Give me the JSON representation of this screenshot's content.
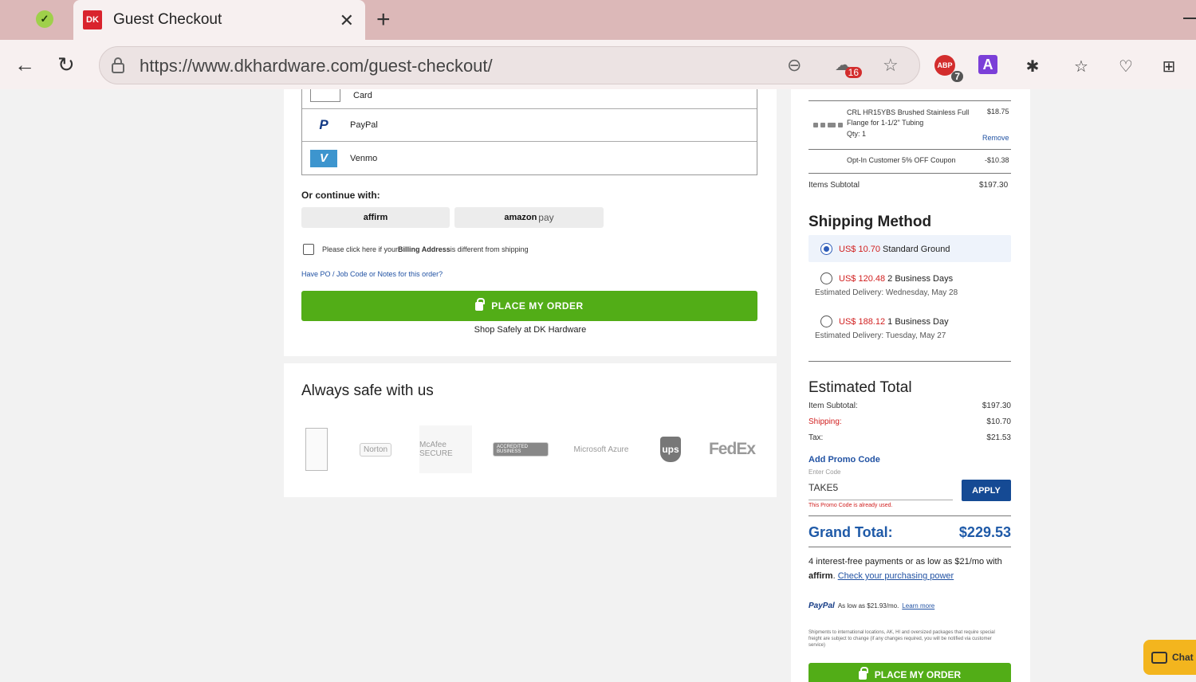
{
  "browser": {
    "tab_title": "Guest Checkout",
    "favicon_text": "DK",
    "url": "https://www.dkhardware.com/guest-checkout/",
    "ext_badge_count": "16",
    "abp_label": "ABP",
    "abp_badge": "7",
    "a_ext_label": "A"
  },
  "payment": {
    "options": [
      {
        "label": "Card",
        "icon": "card-icon"
      },
      {
        "label": "PayPal",
        "icon": "paypal-icon"
      },
      {
        "label": "Venmo",
        "icon": "venmo-icon"
      }
    ],
    "continue_label": "Or continue with:",
    "affirm_label": "affirm",
    "amazon_label_a": "amazon",
    "amazon_label_b": "pay",
    "billing_text_1": "Please click here if your ",
    "billing_text_bold": "Billing Address",
    "billing_text_2": " is different from shipping",
    "po_link": "Have PO / Job Code or Notes for this order?",
    "place_order": "PLACE MY ORDER",
    "shop_safely": "Shop Safely at DK Hardware"
  },
  "safe": {
    "title": "Always safe with us",
    "logos": [
      "Norton",
      "McAfee SECURE",
      "ACCREDITED BUSINESS",
      "Microsoft Azure",
      "ups",
      "FedEx"
    ]
  },
  "cart": {
    "item_name": "CRL HR15YBS Brushed Stainless Full Flange for 1-1/2\" Tubing",
    "item_qty": "Qty: 1",
    "item_price": "$18.75",
    "remove": "Remove",
    "coupon_label": "Opt-In Customer 5% OFF Coupon",
    "coupon_value": "-$10.38",
    "items_subtotal_label": "Items Subtotal",
    "items_subtotal_value": "$197.30"
  },
  "shipping": {
    "title": "Shipping Method",
    "options": [
      {
        "price": "US$ 10.70",
        "name": "Standard Ground",
        "est": "",
        "selected": true
      },
      {
        "price": "US$ 120.48",
        "name": "2 Business Days",
        "est": "Estimated Delivery: Wednesday, May 28",
        "selected": false
      },
      {
        "price": "US$ 188.12",
        "name": "1 Business Day",
        "est": "Estimated Delivery: Tuesday, May 27",
        "selected": false
      }
    ]
  },
  "totals": {
    "title": "Estimated Total",
    "item_subtotal_label": "Item Subtotal:",
    "item_subtotal_value": "$197.30",
    "shipping_label": "Shipping:",
    "shipping_value": "$10.70",
    "tax_label": "Tax:",
    "tax_value": "$21.53",
    "promo_link": "Add Promo Code",
    "promo_hint": "Enter Code",
    "promo_value": "TAKE5",
    "apply": "APPLY",
    "promo_error": "This Promo Code is already used.",
    "grand_label": "Grand Total:",
    "grand_value": "$229.53",
    "affirm_1": "4 interest-free payments or as low as $21/mo with",
    "affirm_word": "affirm",
    "affirm_link": "Check your purchasing power",
    "paypal_word": "PayPal",
    "paypal_text": "As low as $21.93/mo.",
    "paypal_link": "Learn more",
    "ship_note": "Shipments to international locations, AK, HI and oversized packages that require special freight are subject to change (if any changes required, you will be notified via customer service)",
    "place_order": "PLACE MY ORDER"
  },
  "chat": {
    "label": "Chat"
  }
}
